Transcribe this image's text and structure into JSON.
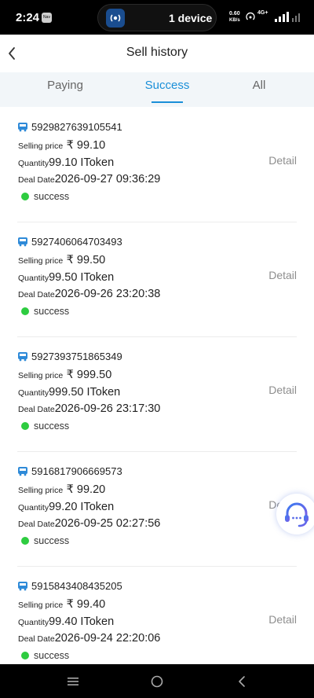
{
  "status_bar": {
    "time": "2:24",
    "app_badge": "Nav",
    "pill_text": "1 device",
    "speed_value": "0.60",
    "speed_unit": "KB/s",
    "network": "4G+"
  },
  "header": {
    "title": "Sell history"
  },
  "tabs": [
    {
      "label": "Paying",
      "active": false
    },
    {
      "label": "Success",
      "active": true
    },
    {
      "label": "All",
      "active": false
    }
  ],
  "labels": {
    "selling_price": "Selling price",
    "quantity": "Quantity",
    "deal_date": "Deal Date",
    "detail": "Detail",
    "currency": "₹"
  },
  "orders": [
    {
      "id": "5929827639105541",
      "price": "₹ 99.10",
      "quantity": "99.10 IToken",
      "date": "2026-09-27 09:36:29",
      "status": "success",
      "detail": "Detail"
    },
    {
      "id": "5927406064703493",
      "price": "₹ 99.50",
      "quantity": "99.50 IToken",
      "date": "2026-09-26 23:20:38",
      "status": "success",
      "detail": "Detail"
    },
    {
      "id": "5927393751865349",
      "price": "₹ 999.50",
      "quantity": "999.50 IToken",
      "date": "2026-09-26 23:17:30",
      "status": "success",
      "detail": "Detail"
    },
    {
      "id": "5916817906669573",
      "price": "₹ 99.20",
      "quantity": "99.20 IToken",
      "date": "2026-09-25 02:27:56",
      "status": "success",
      "detail": "Detail"
    },
    {
      "id": "5915843408435205",
      "price": "₹ 99.40",
      "quantity": "99.40 IToken",
      "date": "2026-09-24 22:20:06",
      "status": "success",
      "detail": "Detail"
    }
  ],
  "colors": {
    "accent": "#1a8fd8",
    "success_dot": "#2ecc40",
    "tab_bar_bg": "#f2f6f9"
  },
  "icons": {
    "back": "chevron-left-icon",
    "order": "bus-icon",
    "support": "headset-icon",
    "nav_menu": "menu-icon",
    "nav_home": "home-circle-icon",
    "nav_back": "back-triangle-icon"
  }
}
